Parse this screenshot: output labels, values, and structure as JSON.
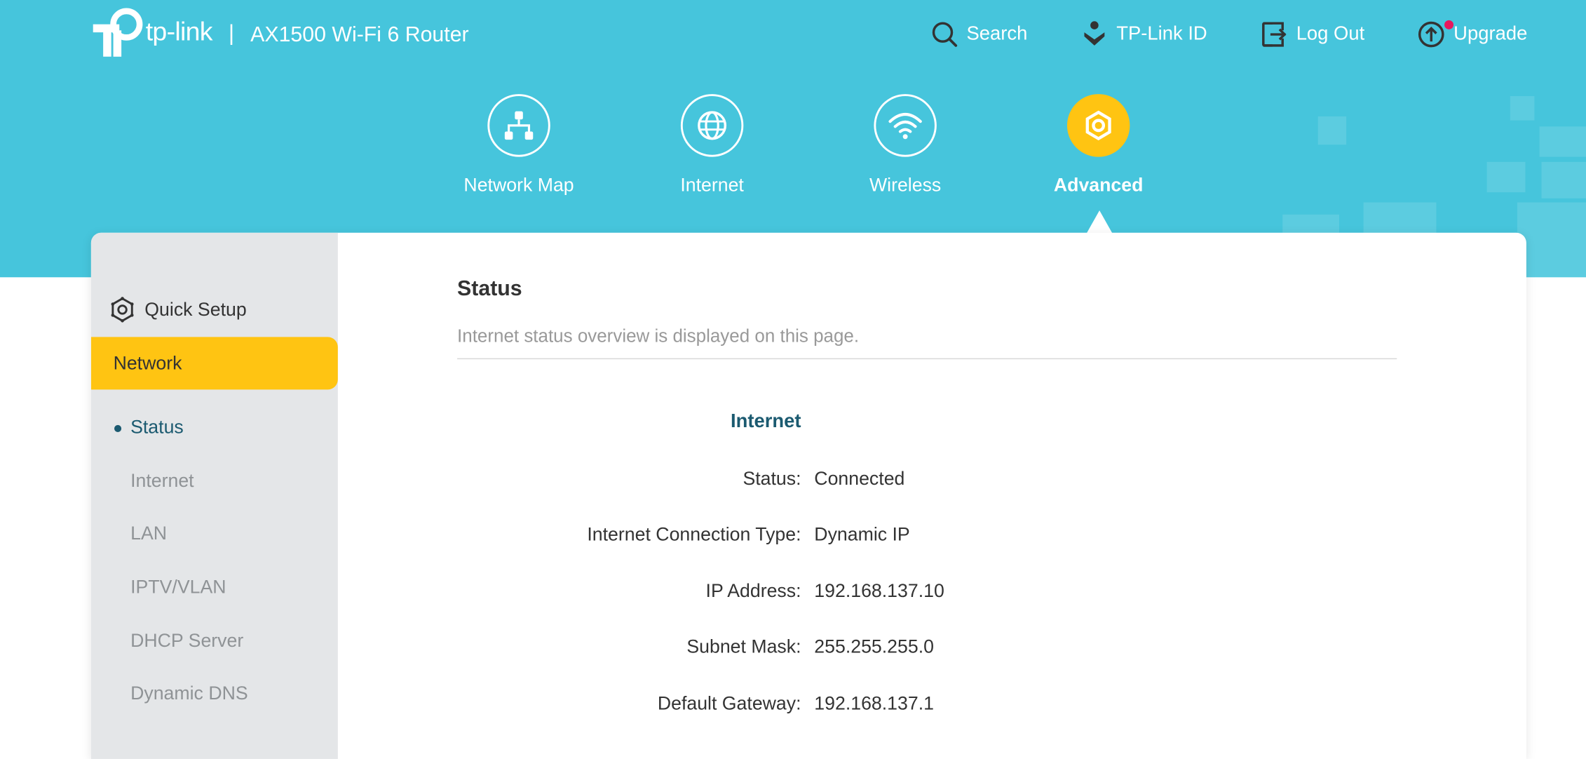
{
  "brand": {
    "logo_text": "tp-link",
    "separator": "|",
    "product": "AX1500 Wi-Fi 6 Router"
  },
  "top_nav": [
    {
      "label": "Search",
      "icon": "search-icon"
    },
    {
      "label": "TP-Link ID",
      "icon": "user-id-icon"
    },
    {
      "label": "Log Out",
      "icon": "logout-icon"
    },
    {
      "label": "Upgrade",
      "icon": "upgrade-icon",
      "badge": true
    }
  ],
  "main_nav": [
    {
      "label": "Network Map",
      "icon": "network-map-icon",
      "active": false
    },
    {
      "label": "Internet",
      "icon": "globe-icon",
      "active": false
    },
    {
      "label": "Wireless",
      "icon": "wifi-icon",
      "active": false
    },
    {
      "label": "Advanced",
      "icon": "gear-icon",
      "active": true
    }
  ],
  "sidebar": {
    "quick_setup": "Quick Setup",
    "section": "Network",
    "items": [
      {
        "label": "Status",
        "active": true
      },
      {
        "label": "Internet",
        "active": false
      },
      {
        "label": "LAN",
        "active": false
      },
      {
        "label": "IPTV/VLAN",
        "active": false
      },
      {
        "label": "DHCP Server",
        "active": false
      },
      {
        "label": "Dynamic DNS",
        "active": false
      }
    ]
  },
  "content": {
    "title": "Status",
    "description": "Internet status overview is displayed on this page.",
    "section": "Internet",
    "rows": [
      {
        "key": "Status:",
        "value": "Connected"
      },
      {
        "key": "Internet Connection Type:",
        "value": "Dynamic IP"
      },
      {
        "key": "IP Address:",
        "value": "192.168.137.10"
      },
      {
        "key": "Subnet Mask:",
        "value": "255.255.255.0"
      },
      {
        "key": "Default Gateway:",
        "value": "192.168.137.1"
      }
    ]
  },
  "colors": {
    "header_bg": "#46c5dc",
    "accent_yellow": "#ffc412",
    "badge_pink": "#e8175d",
    "section_teal": "#1b5a70",
    "sidebar_bg": "#e4e6e8"
  }
}
